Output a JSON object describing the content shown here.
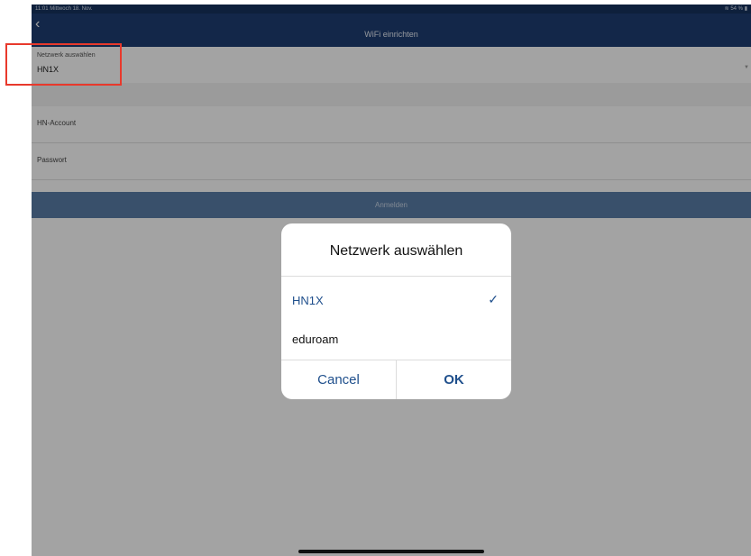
{
  "status_bar": {
    "time": "11:01  Mittwoch 18. Nov.",
    "battery": "54 %"
  },
  "nav": {
    "back_icon": "chevron-left-icon",
    "title": "WiFi einrichten"
  },
  "network_field": {
    "label": "Netzwerk auswählen",
    "value": "HN1X"
  },
  "account_field": {
    "label": "HN-Account"
  },
  "password_field": {
    "label": "Passwort"
  },
  "login_button": {
    "label": "Anmelden"
  },
  "dialog": {
    "title": "Netzwerk auswählen",
    "options": [
      {
        "label": "HN1X",
        "selected": true
      },
      {
        "label": "eduroam",
        "selected": false
      }
    ],
    "cancel_label": "Cancel",
    "ok_label": "OK"
  },
  "colors": {
    "nav": "#1e3e72",
    "accent": "#1f4f8c",
    "highlight": "#e8392c"
  }
}
